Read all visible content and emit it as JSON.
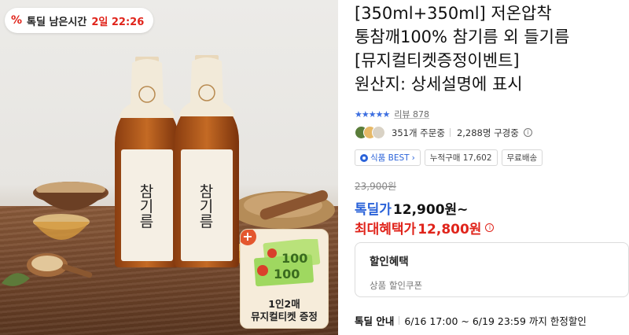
{
  "timer": {
    "label": "톡딜 남은시간",
    "time": "2일 22:26",
    "icon": "percent-icon"
  },
  "bottles": [
    {
      "label": "참기름"
    },
    {
      "label": "참기름"
    }
  ],
  "freebie": {
    "caption_line1": "1인2매",
    "caption_line2": "뮤지컬티켓 증정"
  },
  "product": {
    "title_line1": "[350ml+350ml] 저온압착",
    "title_line2": "통참깨100% 참기름 외 들기름",
    "title_line3": "[뮤지컬티켓증정이벤트]",
    "title_line4": "원산지: 상세설명에 표시"
  },
  "rating": {
    "stars": "★★★★★",
    "review_label": "리뷰 878"
  },
  "stats": {
    "orders": "351개 주문중",
    "subscribers": "2,288명 구경중"
  },
  "tags": [
    {
      "label": "식품 BEST",
      "chevron": "›"
    },
    {
      "label": "누적구매 17,602"
    },
    {
      "label": "무료배송"
    }
  ],
  "price": {
    "original": "23,900원",
    "deal_label": "톡딜가",
    "deal_price": "12,900원~",
    "max_label": "최대혜택가",
    "max_price": "12,800원"
  },
  "benefit": {
    "title": "할인혜택",
    "subtitle": "상품 할인쿠폰"
  },
  "notice": {
    "title": "톡딜 안내",
    "text": "6/16 17:00 ~ 6/19 23:59 까지 한정할인"
  },
  "colors": {
    "accent_blue": "#2b63d9",
    "accent_red": "#e0241b"
  }
}
